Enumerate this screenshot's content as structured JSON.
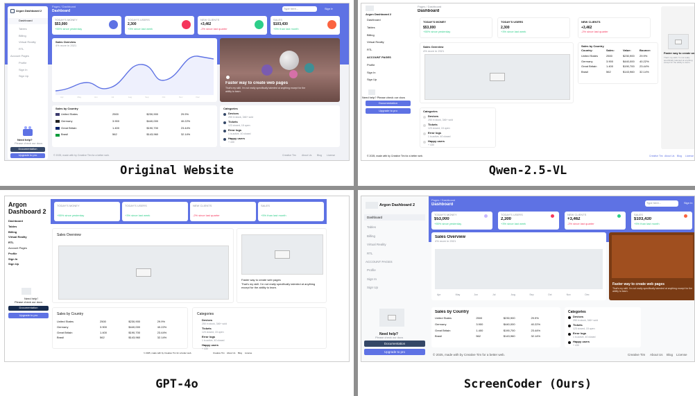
{
  "app": {
    "brand": "Argon Dashboard 2",
    "title": "Dashboard",
    "breadcrumb": "Pages / Dashboard",
    "search_placeholder": "Type here...",
    "sign_in": "Sign In"
  },
  "nav": {
    "items": [
      "Dashboard",
      "Tables",
      "Billing",
      "Virtual Reality",
      "RTL"
    ],
    "section": "ACCOUNT PAGES",
    "section_alt": "Account Pages",
    "account_items": [
      "Profile",
      "Sign In",
      "Sign Up"
    ],
    "help_title": "Need help?",
    "help_sub": "Please check our docs",
    "help_sub_alt": "Need help? Please check our docs",
    "docs": "Documentation",
    "upgrade": "Upgrade to pro"
  },
  "stats": [
    {
      "label": "TODAY'S MONEY",
      "value": "$53,000",
      "delta": "+55% since yesterday",
      "color": "#5e72e4",
      "alt_color": "#c7b7ff"
    },
    {
      "label": "TODAY'S USERS",
      "value": "2,300",
      "delta": "+3% since last week",
      "color": "#f5365c",
      "alt_color": "#f5365c"
    },
    {
      "label": "NEW CLIENTS",
      "value": "+3,462",
      "delta": "-2% since last quarter",
      "color": "#2dce89",
      "alt_color": "#2dce89"
    },
    {
      "label": "SALES",
      "value": "$103,430",
      "delta": "+5% than last month",
      "color": "#fb6340",
      "alt_color": "#fb6340"
    }
  ],
  "sales_overview": {
    "title": "Sales Overview",
    "subtitle": "4% more in 2021",
    "months": [
      "Apr",
      "May",
      "Jun",
      "Jul",
      "Aug",
      "Sep",
      "Oct",
      "Nov",
      "Dec"
    ]
  },
  "promo": {
    "title": "Faster way to create web pages",
    "text": "That's my skill. I'm not really specifically talented at anything except for the ability to learn."
  },
  "sales_table": {
    "title": "Sales by Country",
    "headers": [
      "Country:",
      "Sales:",
      "Value:",
      "Bounce:"
    ],
    "rows": [
      {
        "flag": "US",
        "country": "United States",
        "sales": "2500",
        "value": "$230,900",
        "bounce": "29.9%"
      },
      {
        "flag": "DE",
        "country": "Germany",
        "sales": "3.900",
        "value": "$440,000",
        "bounce": "40.22%"
      },
      {
        "flag": "GB",
        "country": "Great Britain",
        "sales": "1.400",
        "value": "$190,700",
        "bounce": "23.44%"
      },
      {
        "flag": "BR",
        "country": "Brasil",
        "sales": "562",
        "value": "$143,960",
        "bounce": "32.14%"
      }
    ]
  },
  "categories": {
    "title": "Categories",
    "items": [
      {
        "name": "Devices",
        "detail": "250 in stock, 346+ sold"
      },
      {
        "name": "Tickets",
        "detail": "123 closed, 15 open"
      },
      {
        "name": "Error logs",
        "detail": "1 is active, 40 closed"
      },
      {
        "name": "Happy users",
        "detail": "+ 430"
      }
    ]
  },
  "footer": {
    "text": "© 2025, made with by Creative Tim for a better web.",
    "links": [
      "Creative Tim",
      "About Us",
      "Blog",
      "License"
    ]
  },
  "captions": {
    "original": "Original Website",
    "qwen": "Qwen-2.5-VL",
    "gpt": "GPT-4o",
    "ours": "ScreenCoder (Ours)"
  },
  "colors": {
    "primary": "#5e72e4",
    "navy": "#344767",
    "bg": "#f8f9fa"
  }
}
